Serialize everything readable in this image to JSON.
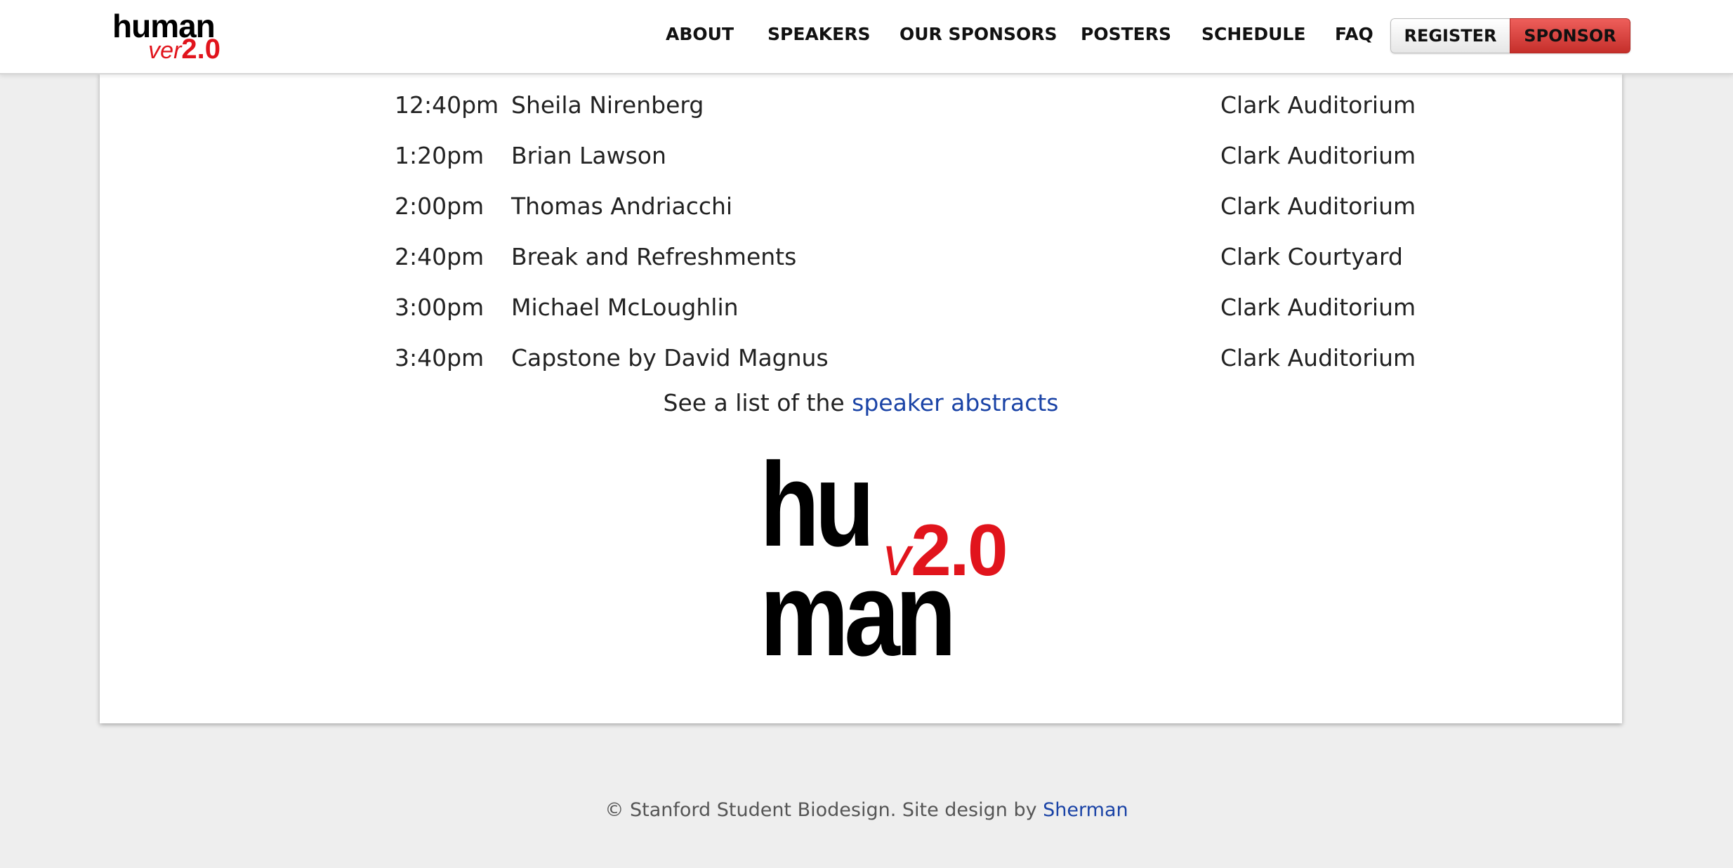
{
  "header": {
    "brand": {
      "top": "human",
      "ver": "ver",
      "num": "2.0"
    },
    "nav": [
      {
        "label": "ABOUT"
      },
      {
        "label": "SPEAKERS"
      },
      {
        "label": "OUR SPONSORS"
      },
      {
        "label": "POSTERS"
      },
      {
        "label": "SCHEDULE"
      },
      {
        "label": "FAQ"
      }
    ],
    "register_label": "REGISTER",
    "sponsor_label": "SPONSOR"
  },
  "schedule": {
    "rows": [
      {
        "time": "12:40pm",
        "event": "Sheila Nirenberg",
        "location": "Clark Auditorium"
      },
      {
        "time": "1:20pm",
        "event": "Brian Lawson",
        "location": "Clark Auditorium"
      },
      {
        "time": "2:00pm",
        "event": "Thomas Andriacchi",
        "location": "Clark Auditorium"
      },
      {
        "time": "2:40pm",
        "event": "Break and Refreshments",
        "location": "Clark Courtyard"
      },
      {
        "time": "3:00pm",
        "event": "Michael McLoughlin",
        "location": "Clark Auditorium"
      },
      {
        "time": "3:40pm",
        "event": "Capstone by David Magnus",
        "location": "Clark Auditorium"
      }
    ],
    "abstracts_prefix": "See a list of the ",
    "abstracts_link": "speaker abstracts"
  },
  "logo": {
    "hu": "hu",
    "man": "man",
    "v": "v",
    "num": "2.0"
  },
  "footer": {
    "text": "© Stanford Student Biodesign. Site design by ",
    "link": "Sherman"
  },
  "colors": {
    "brand_red": "#e1141c",
    "link_blue": "#1a43a6",
    "page_bg": "#eeeeee"
  }
}
